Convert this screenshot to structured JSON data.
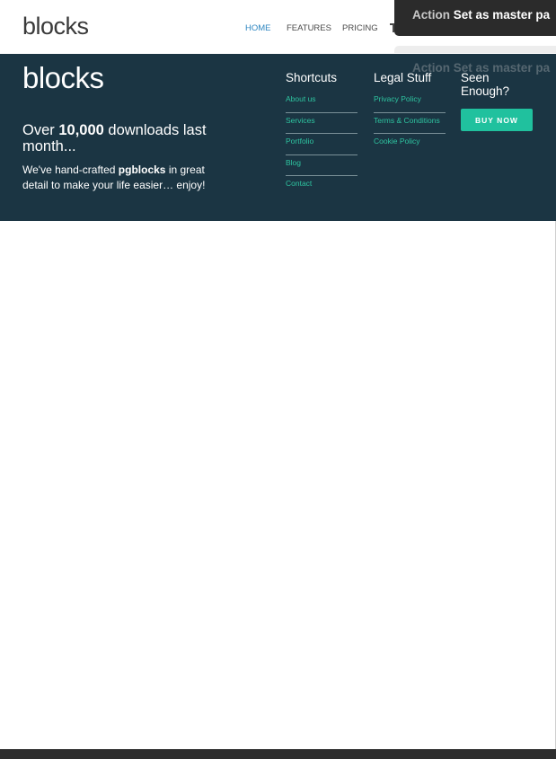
{
  "header": {
    "logo": "blocks",
    "nav": [
      {
        "label": "HOME",
        "active": true
      },
      {
        "label": "FEATURES",
        "active": false
      },
      {
        "label": "PRICING",
        "active": false
      }
    ]
  },
  "toast": {
    "action": "Action",
    "message": "Set as master pa"
  },
  "footer": {
    "logo": "blocks",
    "headline_pre": "Over ",
    "headline_bold": "10,000",
    "headline_post": " downloads last month...",
    "desc_pre": "We've hand-crafted ",
    "desc_bold": "pgblocks",
    "desc_post": " in great detail to make your life easier… enjoy!",
    "shortcuts_title": "Shortcuts",
    "shortcuts": [
      "About us",
      "Services",
      "Portfolio",
      "Blog",
      "Contact"
    ],
    "legal_title": "Legal Stuff",
    "legal": [
      "Privacy Policy",
      "Terms & Conditions",
      "Cookie Policy"
    ],
    "cta_title": "Seen Enough?",
    "cta_button": "BUY NOW"
  },
  "colors": {
    "footer_bg": "#1b3543",
    "accent": "#20c19e",
    "link": "#2ec4a0",
    "nav_active": "#2e86c1"
  }
}
